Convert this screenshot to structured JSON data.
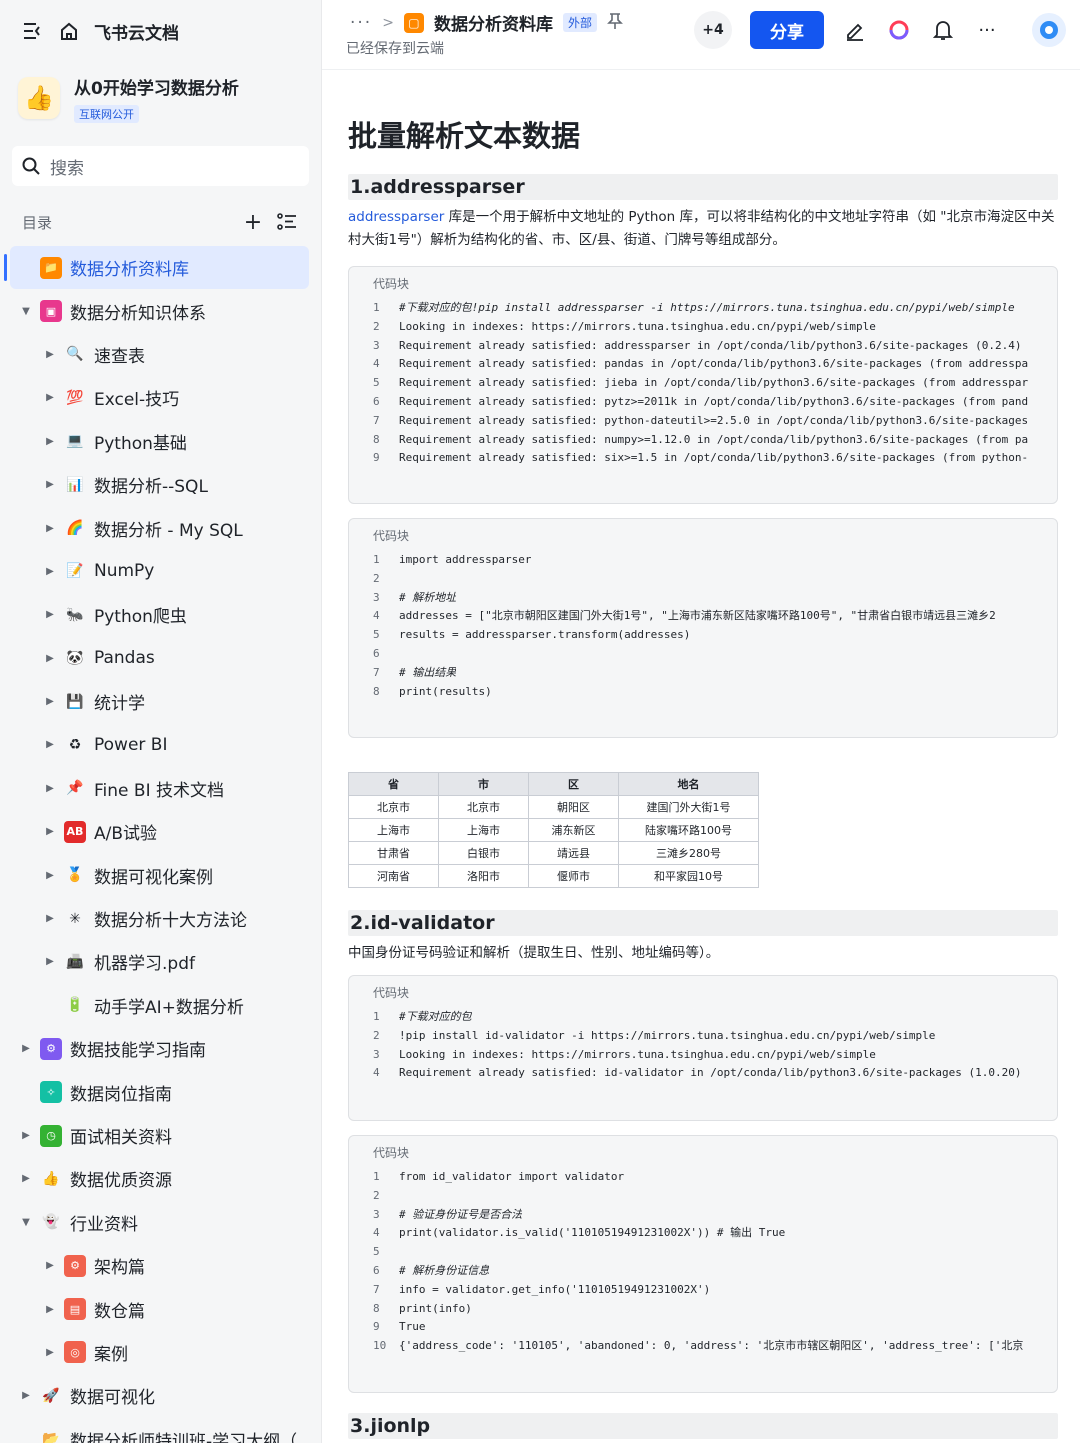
{
  "sidebar": {
    "brand": "飞书云文档",
    "space_title": "从0开始学习数据分析",
    "space_badge": "互联网公开",
    "search_placeholder": "搜索",
    "toc_label": "目录",
    "items": [
      {
        "label": "数据分析资料库",
        "level": 0,
        "arrow": "",
        "icon": "📁",
        "bg": "#ff8800",
        "active": true
      },
      {
        "label": "数据分析知识体系",
        "level": 0,
        "arrow": "▼",
        "icon": "▣",
        "bg": "#e8378d"
      },
      {
        "label": "速查表",
        "level": 1,
        "arrow": "▶",
        "icon": "🔍",
        "bg": ""
      },
      {
        "label": "Excel-技巧",
        "level": 1,
        "arrow": "▶",
        "icon": "💯",
        "bg": ""
      },
      {
        "label": "Python基础",
        "level": 1,
        "arrow": "▶",
        "icon": "💻",
        "bg": ""
      },
      {
        "label": "数据分析--SQL",
        "level": 1,
        "arrow": "▶",
        "icon": "📊",
        "bg": ""
      },
      {
        "label": "数据分析 - My SQL",
        "level": 1,
        "arrow": "▶",
        "icon": "🌈",
        "bg": ""
      },
      {
        "label": "NumPy",
        "level": 1,
        "arrow": "▶",
        "icon": "📝",
        "bg": ""
      },
      {
        "label": "Python爬虫",
        "level": 1,
        "arrow": "▶",
        "icon": "🐜",
        "bg": ""
      },
      {
        "label": "Pandas",
        "level": 1,
        "arrow": "▶",
        "icon": "🐼",
        "bg": ""
      },
      {
        "label": "统计学",
        "level": 1,
        "arrow": "▶",
        "icon": "💾",
        "bg": ""
      },
      {
        "label": "Power BI",
        "level": 1,
        "arrow": "▶",
        "icon": "♻",
        "bg": ""
      },
      {
        "label": "Fine BI 技术文档",
        "level": 1,
        "arrow": "▶",
        "icon": "📌",
        "bg": ""
      },
      {
        "label": "A/B试验",
        "level": 1,
        "arrow": "▶",
        "icon": "AB",
        "bg": "#e22b2b"
      },
      {
        "label": "数据可视化案例",
        "level": 1,
        "arrow": "▶",
        "icon": "🏅",
        "bg": ""
      },
      {
        "label": "数据分析十大方法论",
        "level": 1,
        "arrow": "▶",
        "icon": "✳",
        "bg": ""
      },
      {
        "label": "机器学习.pdf",
        "level": 1,
        "arrow": "▶",
        "icon": "📠",
        "bg": ""
      },
      {
        "label": "动手学AI+数据分析",
        "level": 1,
        "arrow": "",
        "icon": "🔋",
        "bg": ""
      },
      {
        "label": "数据技能学习指南",
        "level": 0,
        "arrow": "▶",
        "icon": "⚙",
        "bg": "#7f5af0"
      },
      {
        "label": "数据岗位指南",
        "level": 0,
        "arrow": "",
        "icon": "✧",
        "bg": "#14c0a4"
      },
      {
        "label": "面试相关资料",
        "level": 0,
        "arrow": "▶",
        "icon": "◷",
        "bg": "#34b233"
      },
      {
        "label": "数据优质资源",
        "level": 0,
        "arrow": "▶",
        "icon": "👍",
        "bg": ""
      },
      {
        "label": "行业资料",
        "level": 0,
        "arrow": "▼",
        "icon": "👻",
        "bg": ""
      },
      {
        "label": "架构篇",
        "level": 1,
        "arrow": "▶",
        "icon": "⚙",
        "bg": "#f0624d"
      },
      {
        "label": "数仓篇",
        "level": 1,
        "arrow": "▶",
        "icon": "▤",
        "bg": "#f0624d"
      },
      {
        "label": "案例",
        "level": 1,
        "arrow": "▶",
        "icon": "◎",
        "bg": "#f0624d"
      },
      {
        "label": "数据可视化",
        "level": 0,
        "arrow": "▶",
        "icon": "🚀",
        "bg": ""
      },
      {
        "label": "数据分析师特训班-学习大纲（…",
        "level": 0,
        "arrow": "",
        "icon": "📂",
        "bg": ""
      }
    ]
  },
  "topbar": {
    "breadcrumb_dots": "···",
    "doc_name": "数据分析资料库",
    "external_tag": "外部",
    "saved_status": "已经保存到云端",
    "collaborators_more": "+4",
    "share_label": "分享"
  },
  "content": {
    "title": "批量解析文本数据",
    "sections": {
      "s1": {
        "heading": "1.addressparser",
        "desc_kw": "addressparser",
        "desc_rest": " 库是一个用于解析中文地址的 Python 库，可以将非结构化的中文地址字符串（如 \"北京市海淀区中关村大街1号\"）解析为结构化的省、市、区/县、街道、门牌号等组成部分。"
      },
      "s2": {
        "heading": "2.id-validator",
        "desc": "中国身份证号码验证和解析（提取生日、性别、地址编码等）。"
      },
      "s3": {
        "heading": "3.jionlp"
      }
    },
    "code_label": "代码块",
    "code_block_1": [
      "#下载对应的包!pip install addressparser -i https://mirrors.tuna.tsinghua.edu.cn/pypi/web/simple",
      "Looking in indexes: https://mirrors.tuna.tsinghua.edu.cn/pypi/web/simple",
      "Requirement already satisfied: addressparser in /opt/conda/lib/python3.6/site-packages (0.2.4)",
      "Requirement already satisfied: pandas in /opt/conda/lib/python3.6/site-packages (from addresspa",
      "Requirement already satisfied: jieba in /opt/conda/lib/python3.6/site-packages (from addresspar",
      "Requirement already satisfied: pytz>=2011k in /opt/conda/lib/python3.6/site-packages (from pand",
      "Requirement already satisfied: python-dateutil>=2.5.0 in /opt/conda/lib/python3.6/site-packages",
      "Requirement already satisfied: numpy>=1.12.0 in /opt/conda/lib/python3.6/site-packages (from pa",
      "Requirement already satisfied: six>=1.5 in /opt/conda/lib/python3.6/site-packages (from python-"
    ],
    "code_block_2": [
      "import addressparser",
      "",
      "# 解析地址",
      "addresses = [\"北京市朝阳区建国门外大街1号\", \"上海市浦东新区陆家嘴环路100号\", \"甘肃省白银市靖远县三滩乡2",
      "results = addressparser.transform(addresses)",
      "",
      "# 输出结果",
      "print(results)"
    ],
    "table": {
      "headers": [
        "省",
        "市",
        "区",
        "地名"
      ],
      "rows": [
        [
          "北京市",
          "北京市",
          "朝阳区",
          "建国门外大街1号"
        ],
        [
          "上海市",
          "上海市",
          "浦东新区",
          "陆家嘴环路100号"
        ],
        [
          "甘肃省",
          "白银市",
          "靖远县",
          "三滩乡280号"
        ],
        [
          "河南省",
          "洛阳市",
          "偃师市",
          "和平家园10号"
        ]
      ]
    },
    "code_block_3": [
      "#下载对应的包",
      "!pip install id-validator -i https://mirrors.tuna.tsinghua.edu.cn/pypi/web/simple",
      "Looking in indexes: https://mirrors.tuna.tsinghua.edu.cn/pypi/web/simple",
      "Requirement already satisfied: id-validator in /opt/conda/lib/python3.6/site-packages (1.0.20)"
    ],
    "code_block_4": [
      "from id_validator import validator",
      "",
      "# 验证身份证号是否合法",
      "print(validator.is_valid('11010519491231002X'))  # 输出 True",
      "",
      "# 解析身份证信息",
      "info = validator.get_info('11010519491231002X')",
      "print(info)",
      "True",
      "{'address_code': '110105', 'abandoned': 0, 'address': '北京市市辖区朝阳区', 'address_tree': ['北京"
    ]
  }
}
